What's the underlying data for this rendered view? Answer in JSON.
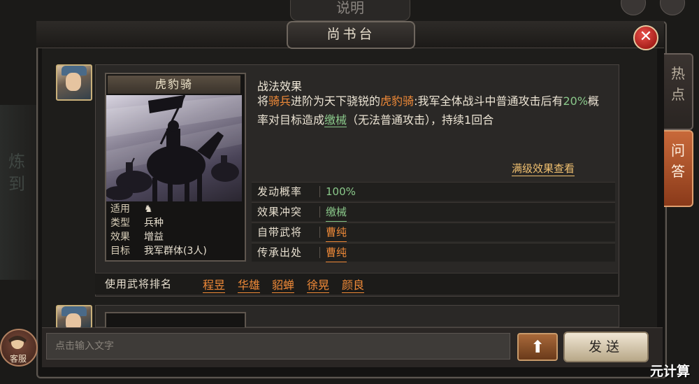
{
  "background": {
    "top_title": "说明",
    "left_text": "炼 到"
  },
  "dialog": {
    "title": "尚书台",
    "close_symbol": "✕"
  },
  "side_tabs": [
    {
      "label": "热\n点",
      "active": false
    },
    {
      "label": "问\n答",
      "active": true
    }
  ],
  "tactic": {
    "unit_name": "虎豹骑",
    "attributes": [
      {
        "key": "适用",
        "value": "♞"
      },
      {
        "key": "类型",
        "value": "兵种"
      },
      {
        "key": "效果",
        "value": "增益"
      },
      {
        "key": "目标",
        "value": "我军群体(3人)"
      }
    ],
    "section_title": "战法效果",
    "desc_p1": "将",
    "desc_troop": "骑兵",
    "desc_p2": "进阶为天下骁锐的",
    "desc_unit": "虎豹骑",
    "desc_p3": ":我军全体战斗中普通攻击后有",
    "desc_rate": "20%",
    "desc_p4": "概率对目标造成",
    "desc_status": "缴械",
    "desc_p5": "（无法普通攻击），持续1回合",
    "full_level_link": "满级效果查看",
    "info_rows": [
      {
        "key": "发动概率",
        "value": "100%",
        "style": "green"
      },
      {
        "key": "效果冲突",
        "value": "缴械",
        "style": "green-ul"
      },
      {
        "key": "自带武将",
        "value": "曹纯",
        "style": "orange-ul"
      },
      {
        "key": "传承出处",
        "value": "曹纯",
        "style": "orange-ul"
      }
    ],
    "users_label": "使用武将排名",
    "users": [
      "程昱",
      "华雄",
      "貂蝉",
      "徐晃",
      "颜良"
    ]
  },
  "input": {
    "placeholder": "点击输入文字",
    "up_symbol": "⬆",
    "send_label": "发送"
  },
  "customer_service_label": "客服",
  "watermark": "元计算",
  "colors": {
    "accent_orange": "#f08a38",
    "accent_green": "#8ac88a",
    "close_red": "#c8302a",
    "active_tab": "#b05a2e"
  }
}
